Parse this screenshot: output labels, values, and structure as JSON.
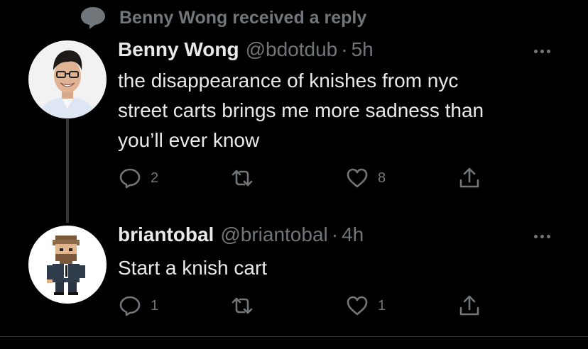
{
  "context": {
    "icon": "speech-bubble-icon",
    "text": "Benny Wong received a reply"
  },
  "tweets": [
    {
      "name": "Benny Wong",
      "handle": "@bdotdub",
      "separator": "·",
      "time": "5h",
      "lines": [
        "the disappearance of knishes from nyc",
        "street carts brings me more sadness than",
        "you’ll ever know"
      ],
      "replies": "2",
      "retweets": "",
      "likes": "8"
    },
    {
      "name": "briantobal",
      "handle": "@briantobal",
      "separator": "·",
      "time": "4h",
      "lines": [
        "Start a knish cart"
      ],
      "replies": "1",
      "retweets": "",
      "likes": "1"
    }
  ],
  "colors": {
    "background": "#000000",
    "primary_text": "#e7e9ea",
    "secondary_text": "#71767b",
    "thread_line": "#333639"
  }
}
